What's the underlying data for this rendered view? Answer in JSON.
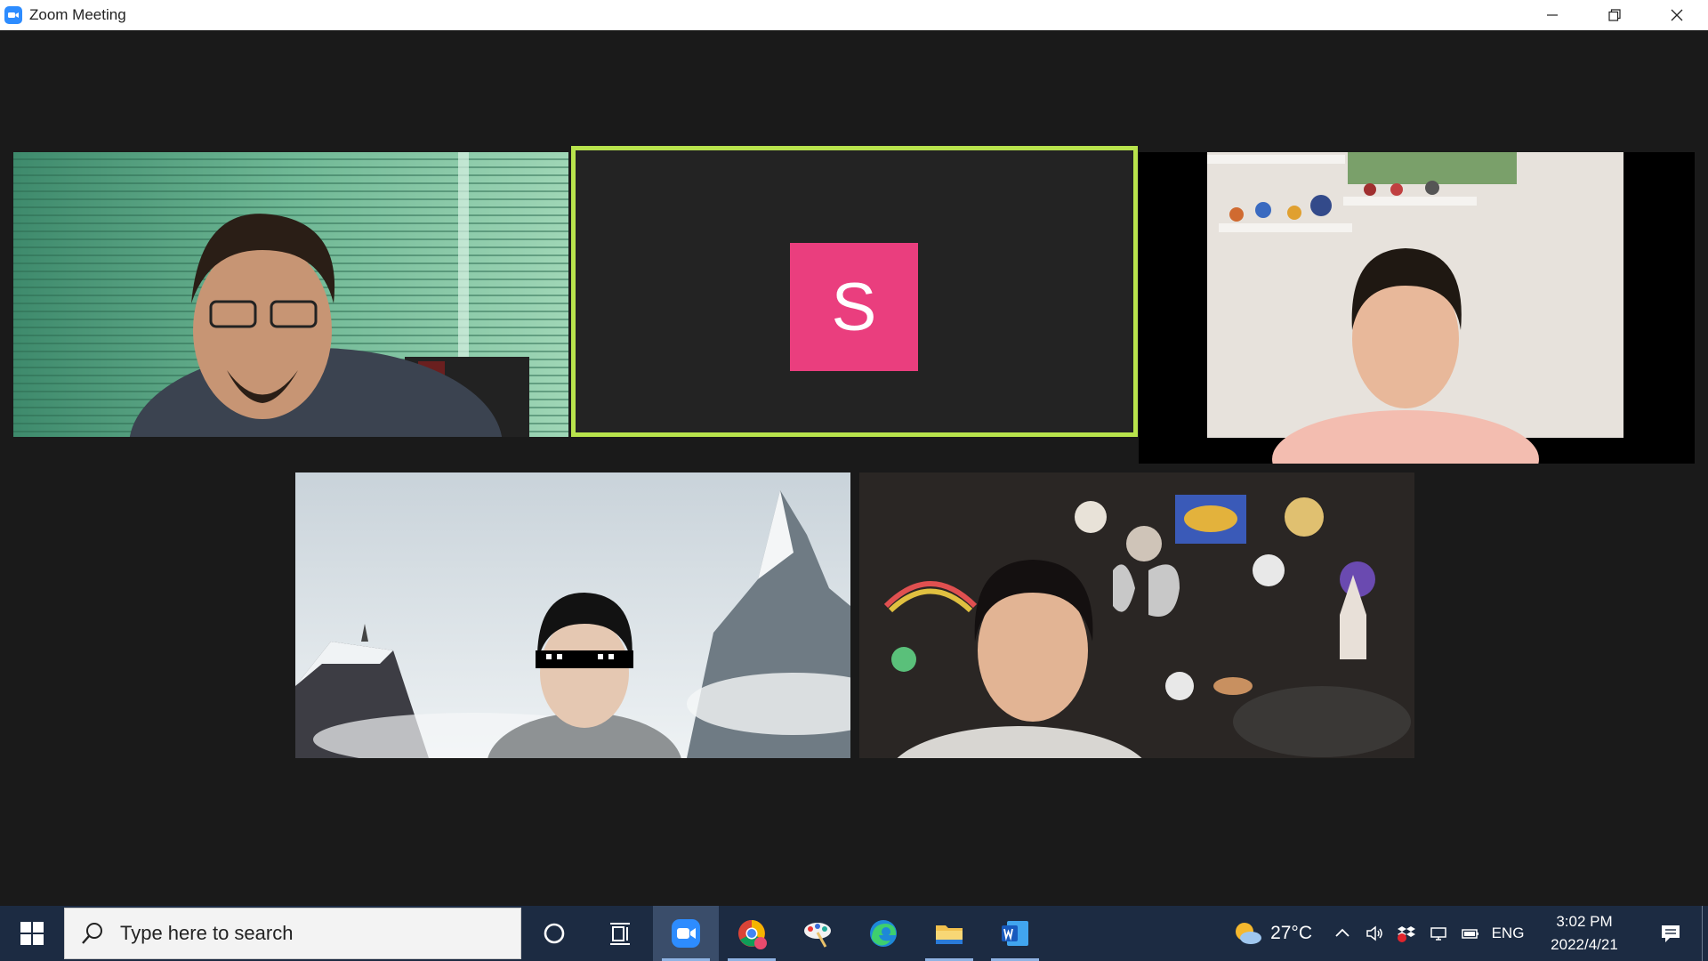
{
  "window": {
    "title": "Zoom Meeting",
    "controls": [
      "minimize-icon",
      "restore-icon",
      "close-icon"
    ]
  },
  "meeting": {
    "active_speaker_color": "#b8e34c",
    "tiles": [
      {
        "kind": "video",
        "scene": "man with glasses in front of green window blinds"
      },
      {
        "kind": "avatar",
        "initial": "S",
        "avatar_color": "#ea3e7e",
        "active_speaker": true
      },
      {
        "kind": "video",
        "scene": "boy in front of white wall with shelf of figurines"
      },
      {
        "kind": "video",
        "scene": "person with pixel sunglasses filter in snowy mountain virtual background"
      },
      {
        "kind": "video",
        "scene": "boy in front of chalkboard with space drawings and balloons"
      }
    ]
  },
  "taskbar": {
    "search_placeholder": "Type here to search",
    "pinned": [
      "cortana-icon",
      "task-view-icon",
      "zoom-icon",
      "chrome-icon",
      "paint-icon",
      "edge-icon",
      "file-explorer-icon",
      "word-icon"
    ],
    "weather": {
      "icon": "partly-cloudy-icon",
      "temperature": "27°C"
    },
    "language": "ENG",
    "time": "3:02 PM",
    "date": "2022/4/21"
  }
}
